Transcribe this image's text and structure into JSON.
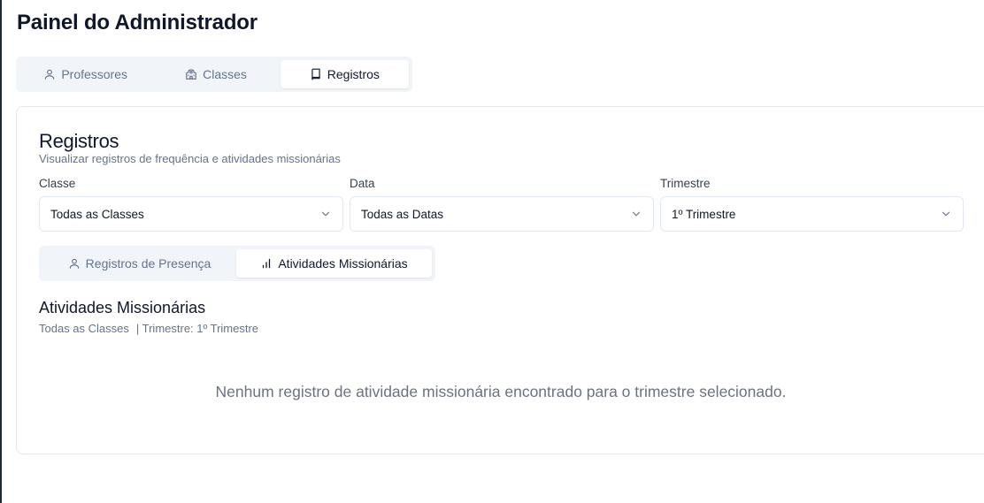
{
  "page": {
    "title": "Painel do Administrador"
  },
  "main_tabs": [
    {
      "label": "Professores",
      "icon": "user-icon",
      "active": false
    },
    {
      "label": "Classes",
      "icon": "school-icon",
      "active": false
    },
    {
      "label": "Registros",
      "icon": "book-icon",
      "active": true
    }
  ],
  "card": {
    "title": "Registros",
    "subtitle": "Visualizar registros de frequência e atividades missionárias"
  },
  "filters": {
    "class": {
      "label": "Classe",
      "value": "Todas as Classes"
    },
    "date": {
      "label": "Data",
      "value": "Todas as Datas"
    },
    "quarter": {
      "label": "Trimestre",
      "value": "1º Trimestre"
    }
  },
  "sub_tabs": [
    {
      "label": "Registros de Presença",
      "icon": "user-icon",
      "active": false
    },
    {
      "label": "Atividades Missionárias",
      "icon": "bar-chart-icon",
      "active": true
    }
  ],
  "section": {
    "title": "Atividades Missionárias",
    "class_filter": "Todas as Classes",
    "quarter_filter": "| Trimestre: 1º Trimestre"
  },
  "empty_message": "Nenhum registro de atividade missionária encontrado para o trimestre selecionado.",
  "colors": {
    "accent_text": "#0f172a",
    "muted_text": "#64748b",
    "tab_bg": "#f1f5f9",
    "border": "#e5e7eb"
  }
}
